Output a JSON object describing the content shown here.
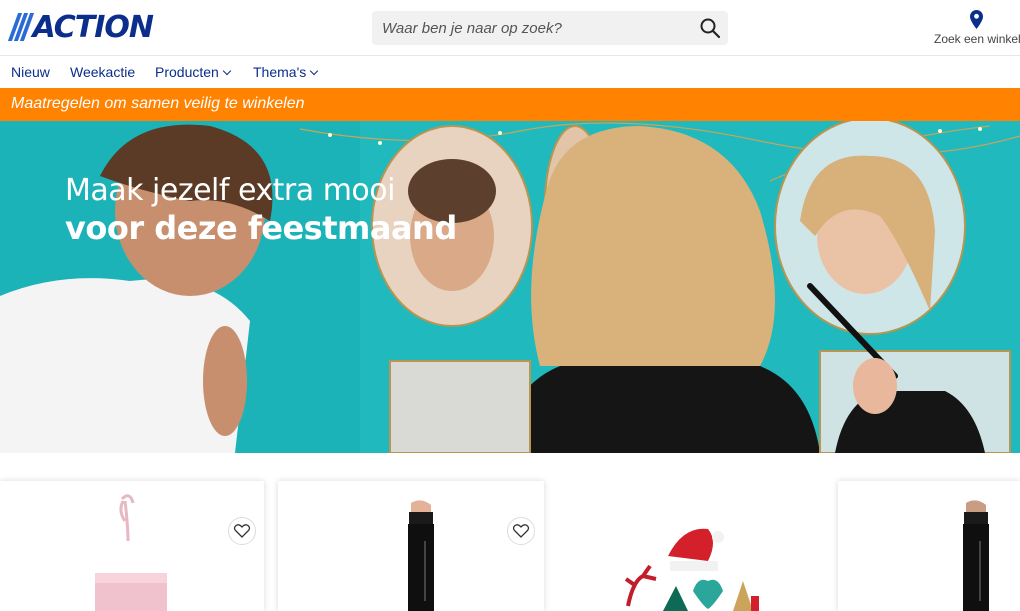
{
  "header": {
    "logo_text": "ACTION",
    "search_placeholder": "Waar ben je naar op zoek?",
    "search_icon": "search-icon",
    "store_label": "Zoek een winkel",
    "store_icon": "location-pin-icon"
  },
  "nav": {
    "items": [
      {
        "label": "Nieuw",
        "dropdown": false
      },
      {
        "label": "Weekactie",
        "dropdown": false
      },
      {
        "label": "Producten",
        "dropdown": true
      },
      {
        "label": "Thema's",
        "dropdown": true
      }
    ]
  },
  "notice": {
    "text": "Maatregelen om samen veilig te winkelen",
    "color": "#ff8200"
  },
  "hero": {
    "line1": "Maak jezelf extra mooi",
    "line2": "voor deze feestmaand",
    "background": "#1cb3b8"
  },
  "products": {
    "cards": [
      {
        "image": "gift-bag",
        "favorite_icon": "heart-icon"
      },
      {
        "image": "makeup-stick",
        "favorite_icon": "heart-icon"
      },
      {
        "image": "christmas-decoration"
      },
      {
        "image": "makeup-stick"
      }
    ]
  },
  "colors": {
    "brand_blue": "#0b2e8c",
    "accent_orange": "#ff8200"
  }
}
